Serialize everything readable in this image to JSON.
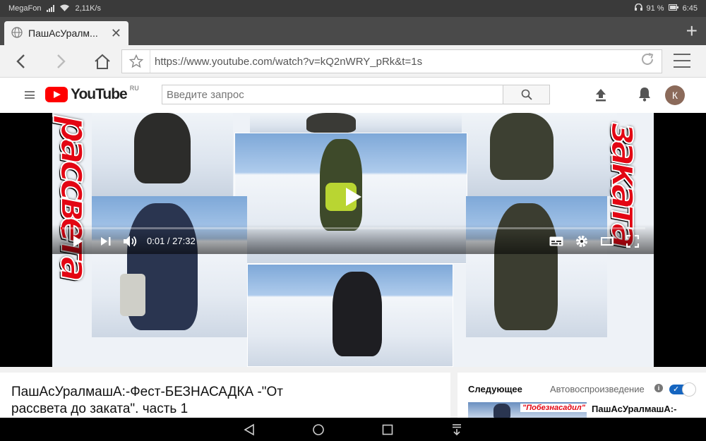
{
  "status": {
    "carrier": "MegaFon",
    "speed": "2,11K/s",
    "battery": "91 %",
    "time": "6:45"
  },
  "browser": {
    "tab_title": "ПашАсУралм...",
    "tab_close": "✕",
    "new_tab": "+",
    "url": "https://www.youtube.com/watch?v=kQ2nWRY_pRk&t=1s"
  },
  "youtube": {
    "logo_text": "YouTube",
    "region": "RU",
    "search_placeholder": "Введите запрос",
    "avatar_letter": "К"
  },
  "player": {
    "overlay_left": "рассвета",
    "overlay_right": "заката",
    "time": "0:01 / 27:32",
    "progress": 0.0006
  },
  "video": {
    "title": "ПашАсУралмашА:-Фест-БЕЗНАСАДКА -\"От рассвета до заката\". часть 1"
  },
  "sidebar": {
    "next_label": "Следующее",
    "autoplay_label": "Автовоспроизведение",
    "autoplay_on": true,
    "thumb_text": "\"Побезнасадил\"",
    "next_title": "ПашАсУралмашА:-"
  },
  "colors": {
    "yt_red": "#ff0000",
    "overlay_red": "#e30613",
    "toggle_blue": "#1565c0"
  }
}
